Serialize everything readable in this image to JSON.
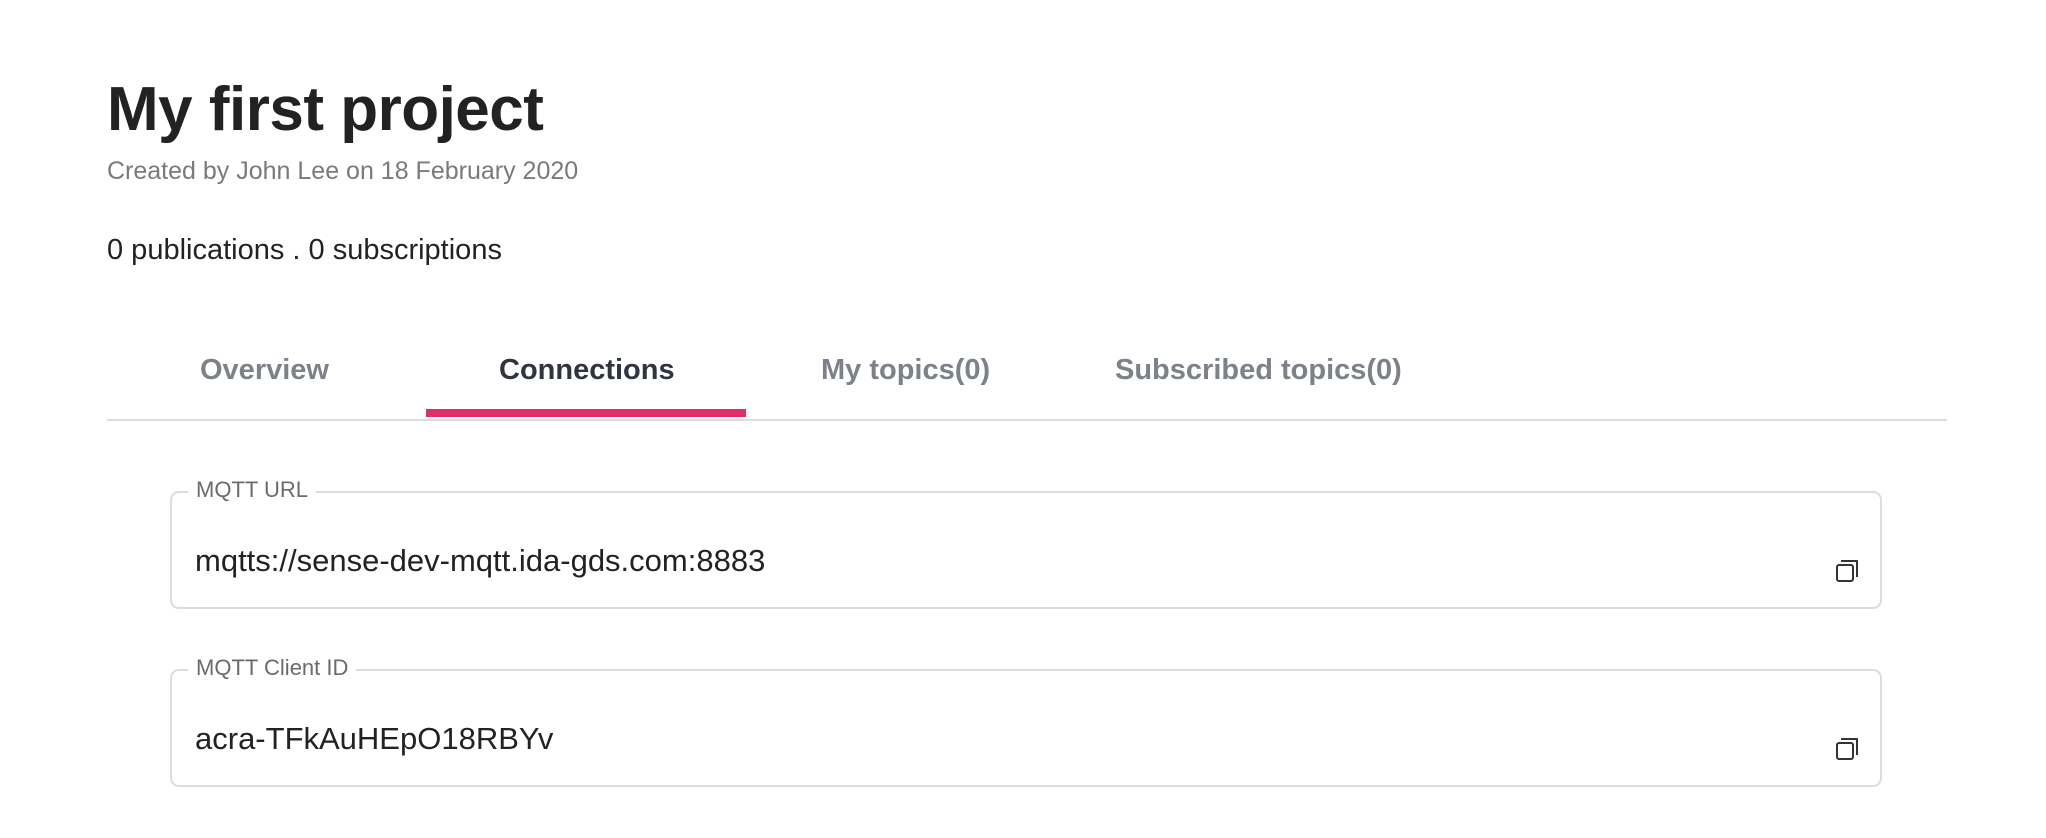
{
  "project": {
    "title": "My first project",
    "created_by": "Created by John Lee on 18 February 2020",
    "stats": "0 publications . 0 subscriptions"
  },
  "tabs": [
    {
      "label": "Overview",
      "active": false
    },
    {
      "label": "Connections",
      "active": true
    },
    {
      "label": "My topics(0)",
      "active": false
    },
    {
      "label": "Subscribed topics(0)",
      "active": false
    }
  ],
  "connections": {
    "mqtt_url": {
      "label": "MQTT URL",
      "value": "mqtts://sense-dev-mqtt.ida-gds.com:8883",
      "copy_icon": "copy-icon"
    },
    "mqtt_client_id": {
      "label": "MQTT Client ID",
      "value": "acra-TFkAuHEpO18RBYv",
      "copy_icon": "copy-icon"
    }
  },
  "colors": {
    "accent": "#e32c6b",
    "active_tab_text": "#2f3440",
    "inactive_tab_text": "#7d828a",
    "border": "#dcdcdc"
  }
}
